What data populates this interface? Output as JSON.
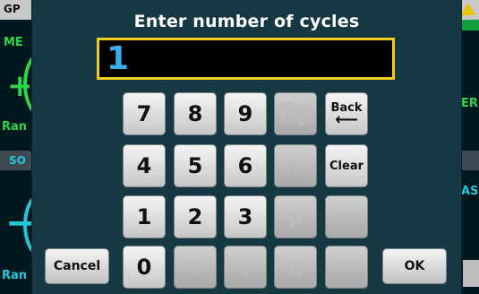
{
  "dialog": {
    "title": "Enter number of cycles",
    "entry_value": "1"
  },
  "keys": {
    "k7": "7",
    "k8": "8",
    "k9": "9",
    "view_engr_line1": "View",
    "view_engr_line2": "Engr",
    "back": "Back",
    "k4": "4",
    "k5": "5",
    "k6": "6",
    "milli": "m",
    "clear": "Clear",
    "k1": "1",
    "k2": "2",
    "k3": "3",
    "micro": "µ",
    "div10": "/10",
    "k0": "0",
    "plusminus": "+/-",
    "dot": ".",
    "nano": "n",
    "x10": "x10"
  },
  "buttons": {
    "cancel": "Cancel",
    "ok": "OK"
  },
  "background": {
    "topbar_left": "GP",
    "label_me": "ME",
    "label_ran1": "Ran",
    "label_so": "SO",
    "label_ran2": "Ran",
    "label_er": "ER",
    "label_as": "AS"
  }
}
